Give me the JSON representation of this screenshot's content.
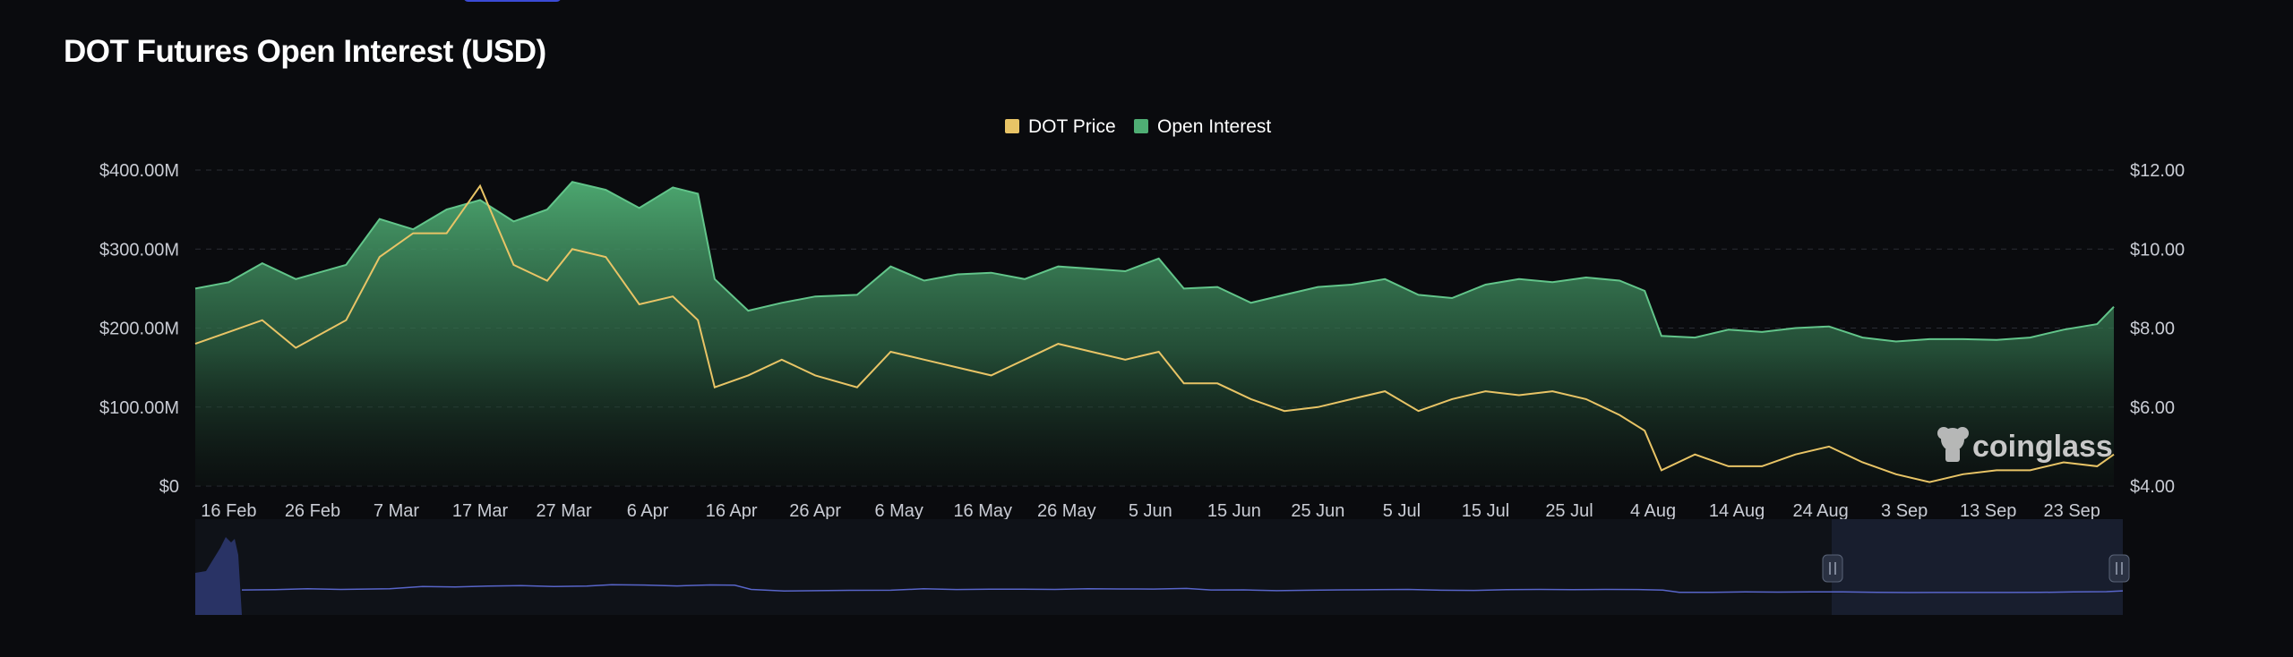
{
  "title": "DOT Futures Open Interest (USD)",
  "watermark": "coinglass",
  "colors": {
    "background": "#0a0b0e",
    "price_line": "#e8c466",
    "oi_fill": "#4fae74",
    "oi_line": "#62c58a",
    "grid": "#2a2d34",
    "navigator": "#5865c9"
  },
  "chart_data": {
    "type": "area",
    "title": "DOT Futures Open Interest (USD)",
    "legend": [
      "DOT Price",
      "Open Interest"
    ],
    "legend_position": "top-center",
    "x_tick_labels": [
      "16 Feb",
      "26 Feb",
      "7 Mar",
      "17 Mar",
      "27 Mar",
      "6 Apr",
      "16 Apr",
      "26 Apr",
      "6 May",
      "16 May",
      "26 May",
      "5 Jun",
      "15 Jun",
      "25 Jun",
      "5 Jul",
      "15 Jul",
      "25 Jul",
      "4 Aug",
      "14 Aug",
      "24 Aug",
      "3 Sep",
      "13 Sep",
      "23 Sep"
    ],
    "y_left_ticks": [
      "$0",
      "$100.00M",
      "$200.00M",
      "$300.00M",
      "$400.00M"
    ],
    "y_right_ticks": [
      "$4.00",
      "$6.00",
      "$8.00",
      "$10.00",
      "$12.00"
    ],
    "ylim_left": [
      0,
      400000000
    ],
    "ylim_right": [
      4,
      12
    ],
    "grid": true,
    "series": [
      {
        "name": "Open Interest",
        "axis": "left",
        "unit": "USD",
        "points": [
          [
            "12 Feb",
            250000000
          ],
          [
            "16 Feb",
            258000000
          ],
          [
            "20 Feb",
            282000000
          ],
          [
            "24 Feb",
            262000000
          ],
          [
            "1 Mar",
            280000000
          ],
          [
            "5 Mar",
            338000000
          ],
          [
            "9 Mar",
            325000000
          ],
          [
            "13 Mar",
            350000000
          ],
          [
            "17 Mar",
            362000000
          ],
          [
            "21 Mar",
            335000000
          ],
          [
            "25 Mar",
            350000000
          ],
          [
            "28 Mar",
            385000000
          ],
          [
            "1 Apr",
            375000000
          ],
          [
            "5 Apr",
            352000000
          ],
          [
            "9 Apr",
            378000000
          ],
          [
            "12 Apr",
            370000000
          ],
          [
            "14 Apr",
            262000000
          ],
          [
            "18 Apr",
            222000000
          ],
          [
            "22 Apr",
            232000000
          ],
          [
            "26 Apr",
            240000000
          ],
          [
            "1 May",
            242000000
          ],
          [
            "5 May",
            278000000
          ],
          [
            "9 May",
            260000000
          ],
          [
            "13 May",
            268000000
          ],
          [
            "17 May",
            270000000
          ],
          [
            "21 May",
            262000000
          ],
          [
            "25 May",
            278000000
          ],
          [
            "29 May",
            275000000
          ],
          [
            "2 Jun",
            272000000
          ],
          [
            "6 Jun",
            288000000
          ],
          [
            "9 Jun",
            250000000
          ],
          [
            "13 Jun",
            252000000
          ],
          [
            "17 Jun",
            232000000
          ],
          [
            "21 Jun",
            242000000
          ],
          [
            "25 Jun",
            252000000
          ],
          [
            "29 Jun",
            255000000
          ],
          [
            "3 Jul",
            262000000
          ],
          [
            "7 Jul",
            242000000
          ],
          [
            "11 Jul",
            238000000
          ],
          [
            "15 Jul",
            255000000
          ],
          [
            "19 Jul",
            262000000
          ],
          [
            "23 Jul",
            258000000
          ],
          [
            "27 Jul",
            264000000
          ],
          [
            "31 Jul",
            260000000
          ],
          [
            "3 Aug",
            247000000
          ],
          [
            "5 Aug",
            190000000
          ],
          [
            "9 Aug",
            188000000
          ],
          [
            "13 Aug",
            198000000
          ],
          [
            "17 Aug",
            195000000
          ],
          [
            "21 Aug",
            200000000
          ],
          [
            "25 Aug",
            202000000
          ],
          [
            "29 Aug",
            188000000
          ],
          [
            "2 Sep",
            183000000
          ],
          [
            "6 Sep",
            186000000
          ],
          [
            "10 Sep",
            186000000
          ],
          [
            "14 Sep",
            185000000
          ],
          [
            "18 Sep",
            188000000
          ],
          [
            "22 Sep",
            198000000
          ],
          [
            "26 Sep",
            205000000
          ],
          [
            "28 Sep",
            227000000
          ]
        ]
      },
      {
        "name": "DOT Price",
        "axis": "right",
        "unit": "USD",
        "points": [
          [
            "12 Feb",
            7.6
          ],
          [
            "16 Feb",
            7.9
          ],
          [
            "20 Feb",
            8.2
          ],
          [
            "24 Feb",
            7.5
          ],
          [
            "1 Mar",
            8.2
          ],
          [
            "5 Mar",
            9.8
          ],
          [
            "9 Mar",
            10.4
          ],
          [
            "13 Mar",
            10.4
          ],
          [
            "17 Mar",
            11.6
          ],
          [
            "21 Mar",
            9.6
          ],
          [
            "25 Mar",
            9.2
          ],
          [
            "28 Mar",
            10.0
          ],
          [
            "1 Apr",
            9.8
          ],
          [
            "5 Apr",
            8.6
          ],
          [
            "9 Apr",
            8.8
          ],
          [
            "12 Apr",
            8.2
          ],
          [
            "14 Apr",
            6.5
          ],
          [
            "18 Apr",
            6.8
          ],
          [
            "22 Apr",
            7.2
          ],
          [
            "26 Apr",
            6.8
          ],
          [
            "1 May",
            6.5
          ],
          [
            "5 May",
            7.4
          ],
          [
            "9 May",
            7.2
          ],
          [
            "13 May",
            7.0
          ],
          [
            "17 May",
            6.8
          ],
          [
            "21 May",
            7.2
          ],
          [
            "25 May",
            7.6
          ],
          [
            "29 May",
            7.4
          ],
          [
            "2 Jun",
            7.2
          ],
          [
            "6 Jun",
            7.4
          ],
          [
            "9 Jun",
            6.6
          ],
          [
            "13 Jun",
            6.6
          ],
          [
            "17 Jun",
            6.2
          ],
          [
            "21 Jun",
            5.9
          ],
          [
            "25 Jun",
            6.0
          ],
          [
            "29 Jun",
            6.2
          ],
          [
            "3 Jul",
            6.4
          ],
          [
            "7 Jul",
            5.9
          ],
          [
            "11 Jul",
            6.2
          ],
          [
            "15 Jul",
            6.4
          ],
          [
            "19 Jul",
            6.3
          ],
          [
            "23 Jul",
            6.4
          ],
          [
            "27 Jul",
            6.2
          ],
          [
            "31 Jul",
            5.8
          ],
          [
            "3 Aug",
            5.4
          ],
          [
            "5 Aug",
            4.4
          ],
          [
            "9 Aug",
            4.8
          ],
          [
            "13 Aug",
            4.5
          ],
          [
            "17 Aug",
            4.5
          ],
          [
            "21 Aug",
            4.8
          ],
          [
            "25 Aug",
            5.0
          ],
          [
            "29 Aug",
            4.6
          ],
          [
            "2 Sep",
            4.3
          ],
          [
            "6 Sep",
            4.1
          ],
          [
            "10 Sep",
            4.3
          ],
          [
            "14 Sep",
            4.4
          ],
          [
            "18 Sep",
            4.4
          ],
          [
            "22 Sep",
            4.6
          ],
          [
            "26 Sep",
            4.5
          ],
          [
            "28 Sep",
            4.8
          ]
        ]
      }
    ]
  }
}
